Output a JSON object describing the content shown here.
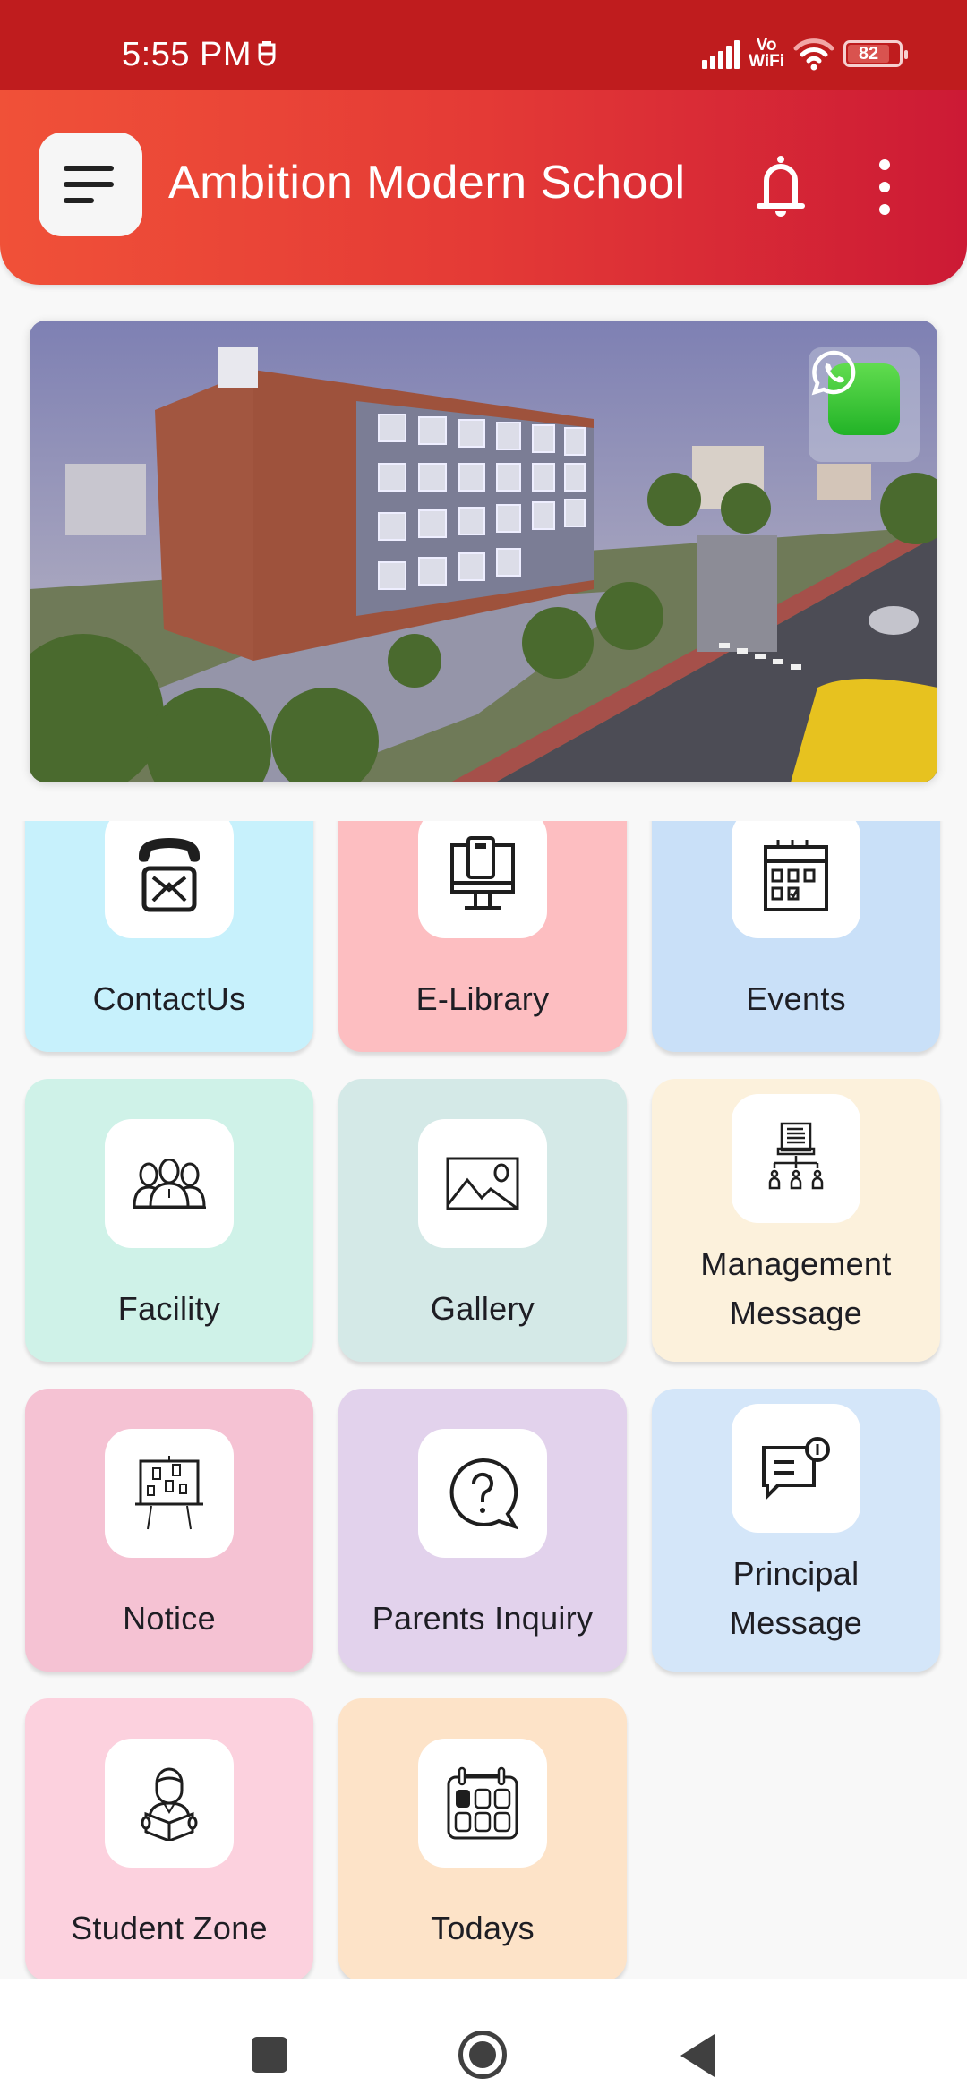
{
  "status_bar": {
    "time": "5:55 PM",
    "vowifi_top": "Vo",
    "vowifi_bottom": "WiFi",
    "battery_level": "82"
  },
  "header": {
    "title": "Ambition Modern School",
    "menu_icon": "hamburger-menu-icon",
    "notification_icon": "bell-icon",
    "more_icon": "more-vertical-icon"
  },
  "banner": {
    "image_description": "Rendered school building with street view",
    "whatsapp_icon": "whatsapp-icon"
  },
  "colors": {
    "status_bar": "#bf1c1e",
    "header_start": "#f05138",
    "header_end": "#cc1a35",
    "background": "#f8f8f8"
  },
  "tiles": [
    {
      "label": "ContactUs",
      "icon": "phone-mail-icon",
      "color": "#c7f1fc"
    },
    {
      "label": "E-Library",
      "icon": "computer-book-icon",
      "color": "#fdbec1"
    },
    {
      "label": "Events",
      "icon": "calendar-check-icon",
      "color": "#c9e0f8"
    },
    {
      "label": "Facility",
      "icon": "group-people-icon",
      "color": "#cff2e8"
    },
    {
      "label": "Gallery",
      "icon": "image-icon",
      "color": "#d4e9e7"
    },
    {
      "label": "Management Message",
      "icon": "hierarchy-document-icon",
      "color": "#fcf1dc"
    },
    {
      "label": "Notice",
      "icon": "notice-board-icon",
      "color": "#f5c2d3"
    },
    {
      "label": "Parents Inquiry",
      "icon": "question-bubble-icon",
      "color": "#e2d2ec"
    },
    {
      "label": "Principal Message",
      "icon": "chat-alert-icon",
      "color": "#d4e6f9"
    },
    {
      "label": "Student Zone",
      "icon": "student-reading-icon",
      "color": "#fcd1de"
    },
    {
      "label": "Todays",
      "icon": "calendar-today-icon",
      "color": "#fde3c8"
    }
  ],
  "nav_bar": {
    "recent_icon": "recent-apps-icon",
    "home_icon": "home-icon",
    "back_icon": "back-icon"
  }
}
